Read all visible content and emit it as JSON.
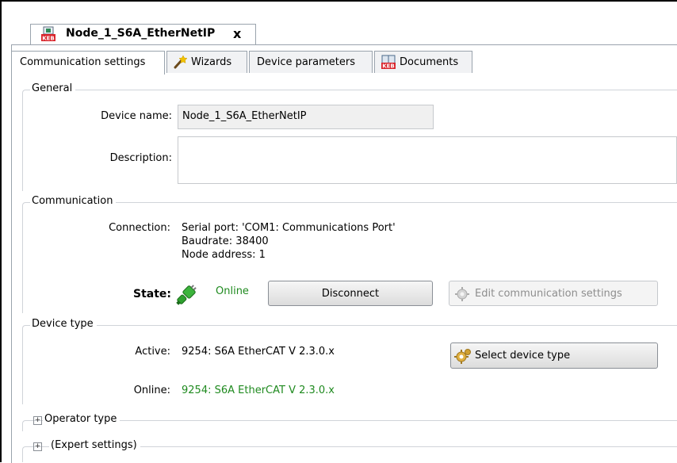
{
  "document_tab": {
    "title": "Node_1_S6A_EtherNetIP",
    "close_glyph": "x"
  },
  "tabs": [
    {
      "label": "Communication settings",
      "active": true
    },
    {
      "label": "Wizards",
      "icon": "wand-icon"
    },
    {
      "label": "Device parameters"
    },
    {
      "label": "Documents",
      "icon": "book-icon"
    }
  ],
  "general": {
    "title": "General",
    "device_name_label": "Device name:",
    "device_name_value": "Node_1_S6A_EtherNetIP",
    "description_label": "Description:"
  },
  "communication": {
    "title": "Communication",
    "connection_label": "Connection:",
    "connection_lines": [
      "Serial port: 'COM1: Communications Port'",
      "Baudrate: 38400",
      "Node address: 1"
    ],
    "state_label": "State:",
    "state_value": "Online",
    "disconnect_label": "Disconnect",
    "edit_label": "Edit communication settings"
  },
  "device_type": {
    "title": "Device type",
    "active_label": "Active:",
    "active_value": "9254: S6A EtherCAT V 2.3.0.x",
    "online_label": "Online:",
    "online_value": "9254: S6A EtherCAT V 2.3.0.x",
    "select_label": "Select device type"
  },
  "operator_type": {
    "title": "Operator type"
  },
  "expert_settings": {
    "title": "(Expert settings)"
  },
  "colors": {
    "online_green": "#1f8a1f",
    "border": "#9aa3ad"
  }
}
